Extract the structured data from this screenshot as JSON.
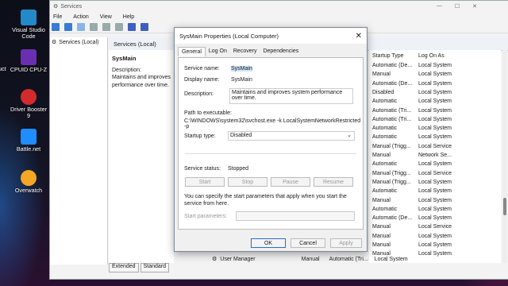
{
  "desktop": {
    "icons": [
      {
        "label": "Visual Studio Code",
        "color": "#2489ca"
      },
      {
        "label": "CPUID CPU-Z",
        "color": "#6a2fb0"
      },
      {
        "label": "Driver Booster 9",
        "color": "#d32b2b"
      },
      {
        "label": "Battle.net",
        "color": "#1f8cff"
      },
      {
        "label": "Overwatch",
        "color": "#f5a623"
      }
    ],
    "cut_label": "uct"
  },
  "services_window": {
    "title": "Services",
    "menu": [
      "File",
      "Action",
      "View",
      "Help"
    ],
    "left_item": "Services (Local)",
    "header": "Services (Local)",
    "selected_name": "SysMain",
    "desc_label": "Description:",
    "desc_text": "Maintains and improves performance over time.",
    "columns": {
      "startup_type": "Startup Type",
      "log_on_as": "Log On As"
    },
    "rows": [
      {
        "startup": "Automatic (De...",
        "logon": "Local System"
      },
      {
        "startup": "Manual",
        "logon": "Local System"
      },
      {
        "startup": "Automatic (De...",
        "logon": "Local System"
      },
      {
        "startup": "Disabled",
        "logon": "Local System"
      },
      {
        "startup": "Automatic",
        "logon": "Local System"
      },
      {
        "startup": "Automatic (Tri...",
        "logon": "Local System"
      },
      {
        "startup": "Automatic (Tri...",
        "logon": "Local System"
      },
      {
        "startup": "Automatic",
        "logon": "Local System"
      },
      {
        "startup": "Automatic",
        "logon": "Local System"
      },
      {
        "startup": "Manual (Trigg...",
        "logon": "Local Service"
      },
      {
        "startup": "Manual",
        "logon": "Network Se..."
      },
      {
        "startup": "Automatic",
        "logon": "Local System"
      },
      {
        "startup": "Manual (Trigg...",
        "logon": "Local Service"
      },
      {
        "startup": "Manual (Trigg...",
        "logon": "Local System"
      },
      {
        "startup": "Automatic",
        "logon": "Local System"
      },
      {
        "startup": "Manual",
        "logon": "Local System"
      },
      {
        "startup": "Automatic",
        "logon": "Local System"
      },
      {
        "startup": "Automatic (De...",
        "logon": "Local System"
      },
      {
        "startup": "Manual",
        "logon": "Local Service"
      },
      {
        "startup": "Manual",
        "logon": "Local System"
      },
      {
        "startup": "Manual",
        "logon": "Local System"
      },
      {
        "startup": "Manual",
        "logon": "Local System"
      }
    ],
    "bottom_tabs": [
      "Extended",
      "Standard"
    ],
    "user_manager": {
      "name": "User Manager",
      "manual": "Manual",
      "startup": "Automatic (Tri...",
      "logon": "Local System"
    }
  },
  "dialog": {
    "title": "SysMain Properties (Local Computer)",
    "tabs": [
      "General",
      "Log On",
      "Recovery",
      "Dependencies"
    ],
    "service_name_label": "Service name:",
    "service_name": "SysMain",
    "display_name_label": "Display name:",
    "display_name": "SysMain",
    "description_label": "Description:",
    "description": "Maintains and improves system performance over time.",
    "path_label": "Path to executable:",
    "path": "C:\\WINDOWS\\system32\\svchost.exe -k LocalSystemNetworkRestricted -p",
    "startup_type_label": "Startup type:",
    "startup_type": "Disabled",
    "status_label": "Service status:",
    "status": "Stopped",
    "buttons": {
      "start": "Start",
      "stop": "Stop",
      "pause": "Pause",
      "resume": "Resume"
    },
    "params_note": "You can specify the start parameters that apply when you start the service from here.",
    "params_label": "Start parameters:",
    "footer": {
      "ok": "OK",
      "cancel": "Cancel",
      "apply": "Apply"
    }
  }
}
